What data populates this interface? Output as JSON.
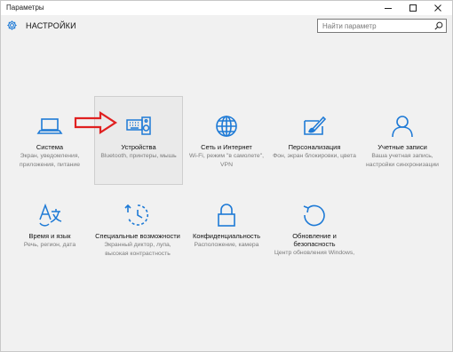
{
  "window": {
    "title": "Параметры"
  },
  "header": {
    "title": "НАСТРОЙКИ"
  },
  "search": {
    "placeholder": "Найти параметр"
  },
  "accent_color": "#1e7ad6",
  "highlight_color": "#e02020",
  "tiles": [
    {
      "icon": "laptop-icon",
      "label": "Система",
      "desc": "Экран, уведомления, приложения, питание"
    },
    {
      "icon": "keyboard-speaker-icon",
      "label": "Устройства",
      "desc": "Bluetooth, принтеры, мышь"
    },
    {
      "icon": "globe-icon",
      "label": "Сеть и Интернет",
      "desc": "Wi-Fi, режим \"в самолете\", VPN"
    },
    {
      "icon": "paint-brush-icon",
      "label": "Персонализация",
      "desc": "Фон, экран блокировки, цвета"
    },
    {
      "icon": "person-icon",
      "label": "Учетные записи",
      "desc": "Ваша учетная запись, настройки синхронизации"
    },
    {
      "icon": "language-icon",
      "label": "Время и язык",
      "desc": "Речь, регион, дата"
    },
    {
      "icon": "accessibility-clock-icon",
      "label": "Специальные возможности",
      "desc": "Экранный диктор, лупа, высокая контрастность"
    },
    {
      "icon": "padlock-icon",
      "label": "Конфиденциальность",
      "desc": "Расположение, камера"
    },
    {
      "icon": "refresh-icon",
      "label": "Обновление и безопасность",
      "desc": "Центр обновления Windows,"
    }
  ]
}
